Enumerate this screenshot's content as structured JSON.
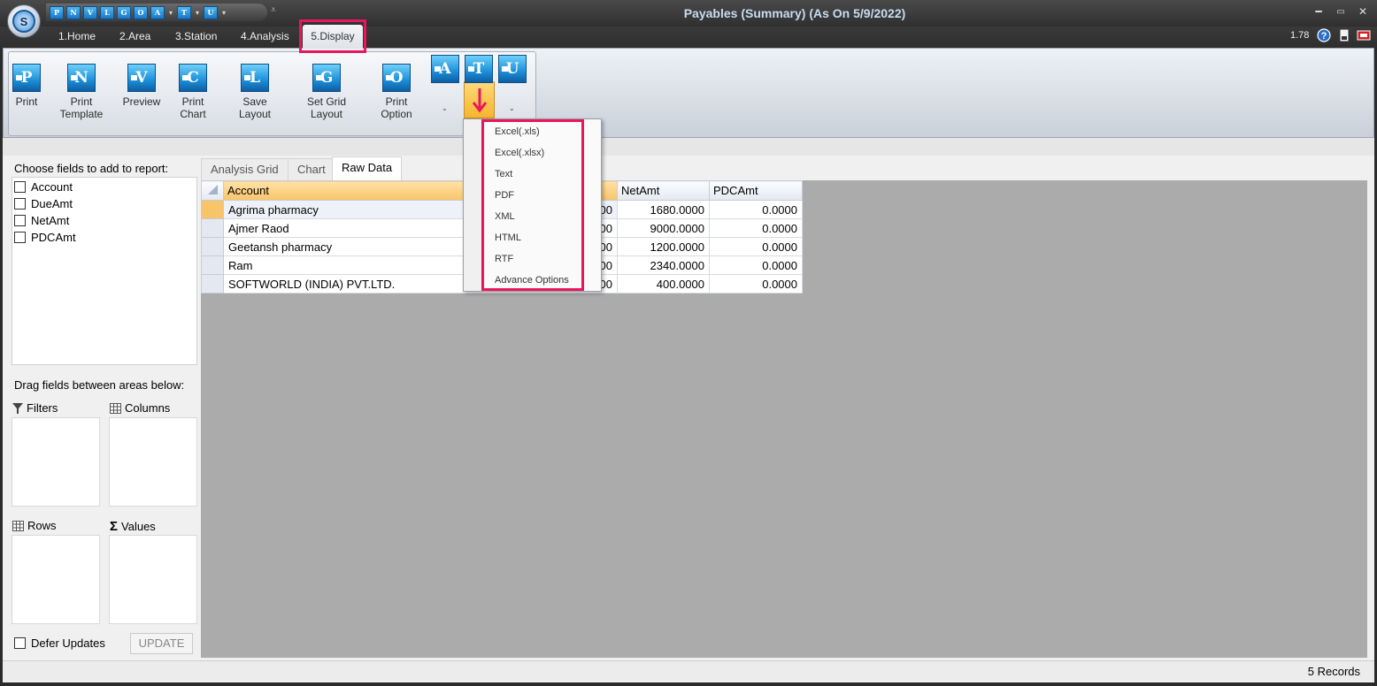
{
  "window": {
    "title": "Payables (Summary) (As On 5/9/2022)",
    "app_logo": "S"
  },
  "quick_access": [
    {
      "letter": "P"
    },
    {
      "letter": "N"
    },
    {
      "letter": "V"
    },
    {
      "letter": "L"
    },
    {
      "letter": "G"
    },
    {
      "letter": "O"
    },
    {
      "letter": "A"
    },
    {
      "letter": "T"
    },
    {
      "letter": "U"
    }
  ],
  "ribbon_tabs": [
    "1.Home",
    "2.Area",
    "3.Station",
    "4.Analysis",
    "5.Display"
  ],
  "header_right": {
    "version": "1.78",
    "help_icon": "?"
  },
  "ribbon_buttons": [
    {
      "letter": "P",
      "label": "Print"
    },
    {
      "letter": "N",
      "label": "Print Template"
    },
    {
      "letter": "V",
      "label": "Preview"
    },
    {
      "letter": "C",
      "label": "Print Chart"
    },
    {
      "letter": "L",
      "label": "Save Layout"
    },
    {
      "letter": "G",
      "label": "Set Grid Layout"
    },
    {
      "letter": "O",
      "label": "Print Option"
    },
    {
      "letter": "A",
      "label": ""
    },
    {
      "letter": "T",
      "label": ""
    },
    {
      "letter": "U",
      "label": ""
    }
  ],
  "left_panel": {
    "choose_label": "Choose fields to add to report:",
    "fields": [
      "Account",
      "DueAmt",
      "NetAmt",
      "PDCAmt"
    ],
    "drag_label": "Drag fields between areas below:",
    "areas": {
      "filters": "Filters",
      "columns": "Columns",
      "rows": "Rows",
      "values": "Values"
    },
    "defer_label": "Defer Updates",
    "update_label": "UPDATE"
  },
  "grid_tabs": [
    "Analysis Grid",
    "Chart",
    "Raw Data"
  ],
  "grid": {
    "columns": [
      "Account",
      "NetAmt",
      "PDCAmt"
    ],
    "rows": [
      {
        "account": "Agrima pharmacy",
        "due_tail": "00",
        "netamt": "1680.0000",
        "pdcamt": "0.0000"
      },
      {
        "account": "Ajmer Raod",
        "due_tail": "00",
        "netamt": "9000.0000",
        "pdcamt": "0.0000"
      },
      {
        "account": "Geetansh pharmacy",
        "due_tail": "00",
        "netamt": "1200.0000",
        "pdcamt": "0.0000"
      },
      {
        "account": "Ram",
        "due_tail": "00",
        "netamt": "2340.0000",
        "pdcamt": "0.0000"
      },
      {
        "account": "SOFTWORLD (INDIA) PVT.LTD.",
        "due_tail": "00",
        "netamt": "400.0000",
        "pdcamt": "0.0000"
      }
    ]
  },
  "export_menu": [
    "Excel(.xls)",
    "Excel(.xlsx)",
    "Text",
    "PDF",
    "XML",
    "HTML",
    "RTF",
    "Advance Options"
  ],
  "status": {
    "records": "5 Records"
  },
  "colors": {
    "highlight_border": "#e8175d",
    "selected_header": "#f8c46a",
    "icon_blue": "#1b8fd8"
  }
}
